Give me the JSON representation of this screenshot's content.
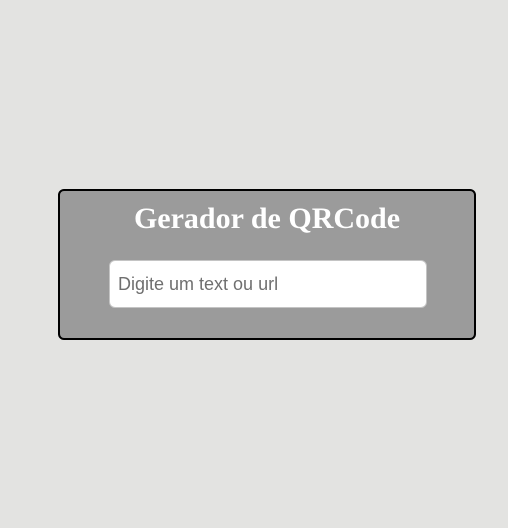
{
  "app": {
    "title": "Gerador de QRCode"
  },
  "form": {
    "input": {
      "value": "",
      "placeholder": "Digite um text ou url"
    }
  },
  "colors": {
    "page_background": "#e3e3e1",
    "card_background": "#9b9b9b",
    "card_border": "#000000",
    "title_text": "#ffffff",
    "input_background": "#ffffff"
  }
}
